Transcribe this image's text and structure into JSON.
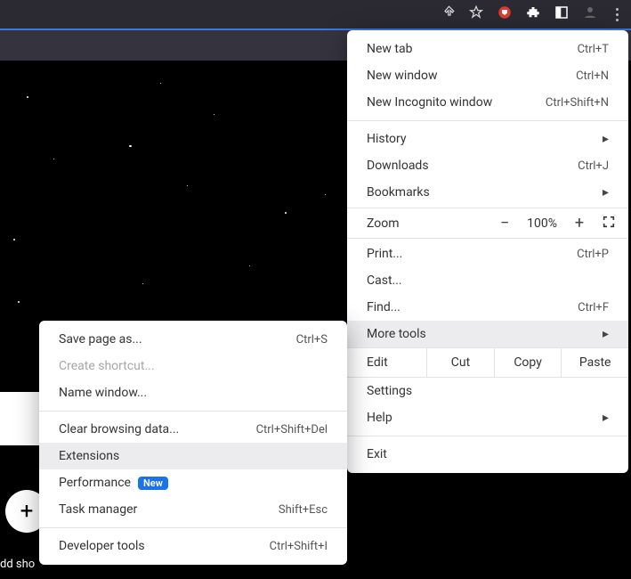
{
  "toolbar": {
    "icons": [
      "share",
      "star",
      "adblock",
      "extensions",
      "sidepanel",
      "profile",
      "menu"
    ]
  },
  "mainMenu": {
    "group1": [
      {
        "label": "New tab",
        "shortcut": "Ctrl+T"
      },
      {
        "label": "New window",
        "shortcut": "Ctrl+N"
      },
      {
        "label": "New Incognito window",
        "shortcut": "Ctrl+Shift+N"
      }
    ],
    "group2": [
      {
        "label": "History",
        "arrow": true
      },
      {
        "label": "Downloads",
        "shortcut": "Ctrl+J"
      },
      {
        "label": "Bookmarks",
        "arrow": true
      }
    ],
    "zoom": {
      "label": "Zoom",
      "minus": "−",
      "value": "100%",
      "plus": "+"
    },
    "group3": [
      {
        "label": "Print...",
        "shortcut": "Ctrl+P"
      },
      {
        "label": "Cast..."
      },
      {
        "label": "Find...",
        "shortcut": "Ctrl+F"
      },
      {
        "label": "More tools",
        "arrow": true,
        "highlight": true
      }
    ],
    "edit": {
      "label": "Edit",
      "cut": "Cut",
      "copy": "Copy",
      "paste": "Paste"
    },
    "group4": [
      {
        "label": "Settings"
      },
      {
        "label": "Help",
        "arrow": true
      }
    ],
    "group5": [
      {
        "label": "Exit"
      }
    ]
  },
  "subMenu": {
    "groupA": [
      {
        "label": "Save page as...",
        "shortcut": "Ctrl+S"
      },
      {
        "label": "Create shortcut...",
        "disabled": true
      },
      {
        "label": "Name window..."
      }
    ],
    "groupB": [
      {
        "label": "Clear browsing data...",
        "shortcut": "Ctrl+Shift+Del"
      },
      {
        "label": "Extensions",
        "highlight": true
      },
      {
        "label": "Performance",
        "badge": "New"
      },
      {
        "label": "Task manager",
        "shortcut": "Shift+Esc"
      }
    ],
    "groupC": [
      {
        "label": "Developer tools",
        "shortcut": "Ctrl+Shift+I"
      }
    ]
  },
  "fab": "+",
  "bottomLabel": "dd sho"
}
